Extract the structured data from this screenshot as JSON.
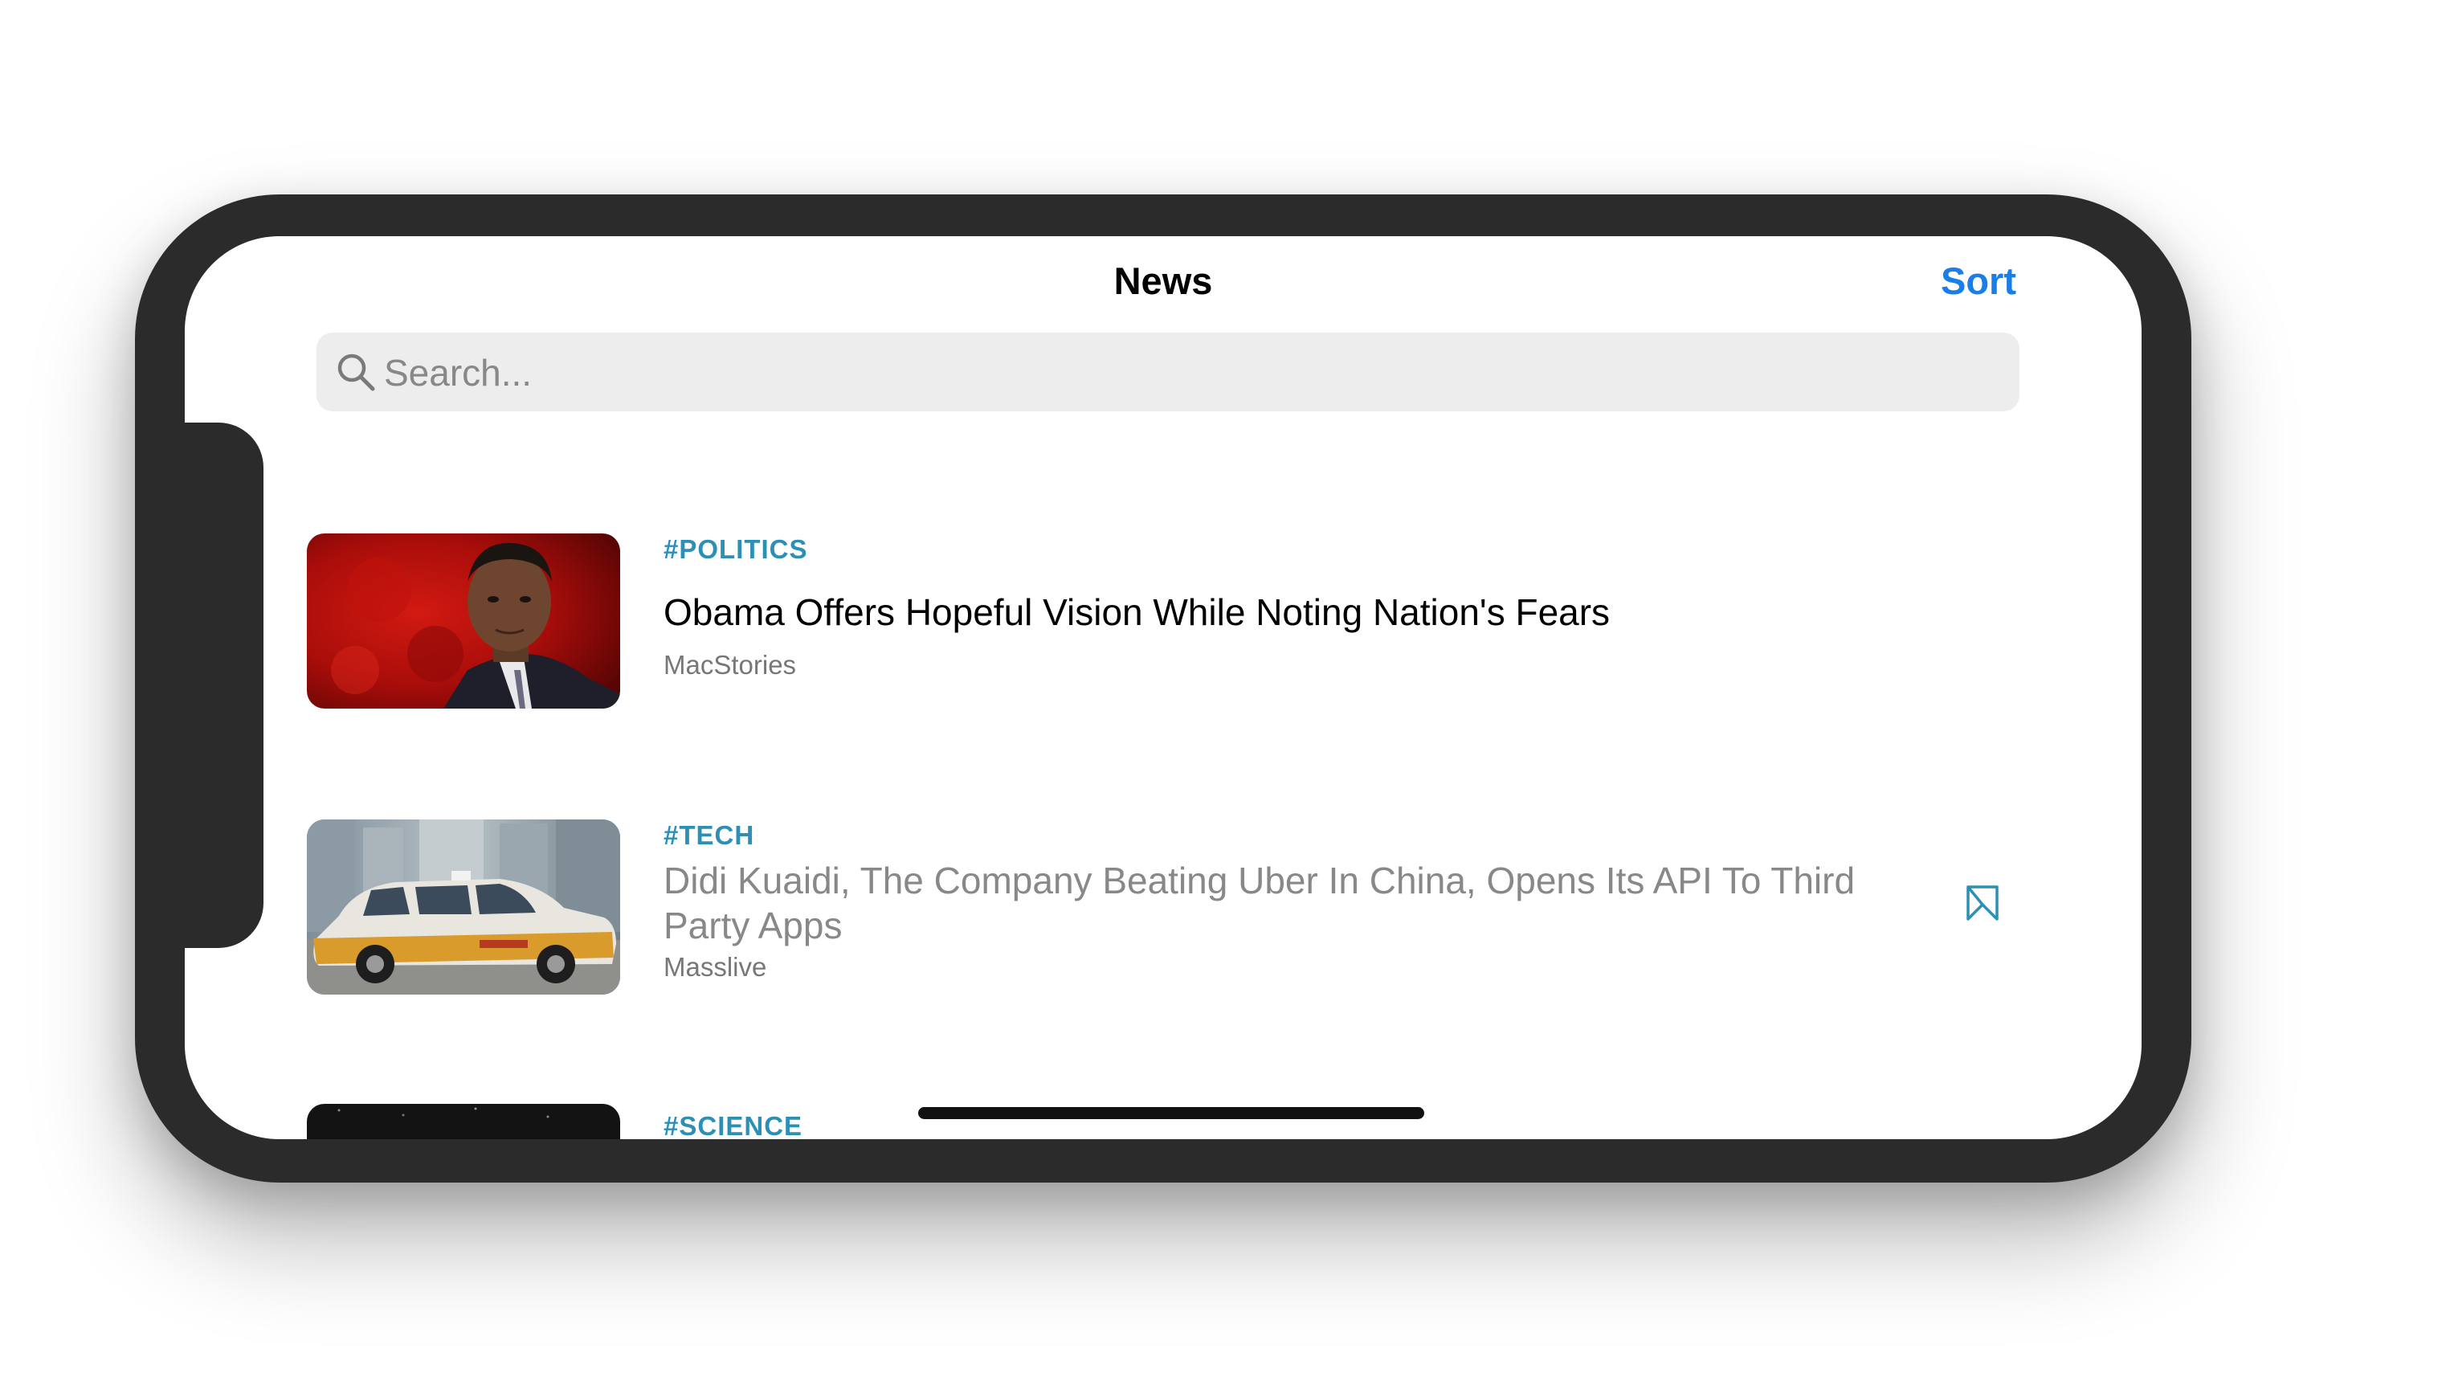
{
  "nav": {
    "title": "News",
    "sort_label": "Sort"
  },
  "search": {
    "placeholder": "Search...",
    "value": ""
  },
  "articles": [
    {
      "tag": "#POLITICS",
      "title": "Obama Offers Hopeful Vision While Noting Nation's Fears",
      "source": "MacStories",
      "read": false,
      "bookmarked": false
    },
    {
      "tag": "#TECH",
      "title": "Didi Kuaidi, The Company Beating Uber In China, Opens Its API To Third Party Apps",
      "source": "Masslive",
      "read": true,
      "bookmarked": true
    },
    {
      "tag": "#SCIENCE",
      "title": "",
      "source": "",
      "read": false,
      "bookmarked": false
    }
  ],
  "colors": {
    "accent": "#1a7ee8",
    "tag": "#2c8fb5",
    "read_text": "#888888",
    "bezel": "#2c2b2c"
  },
  "icons": {
    "search": "search-icon",
    "bookmark": "bookmark-icon"
  }
}
